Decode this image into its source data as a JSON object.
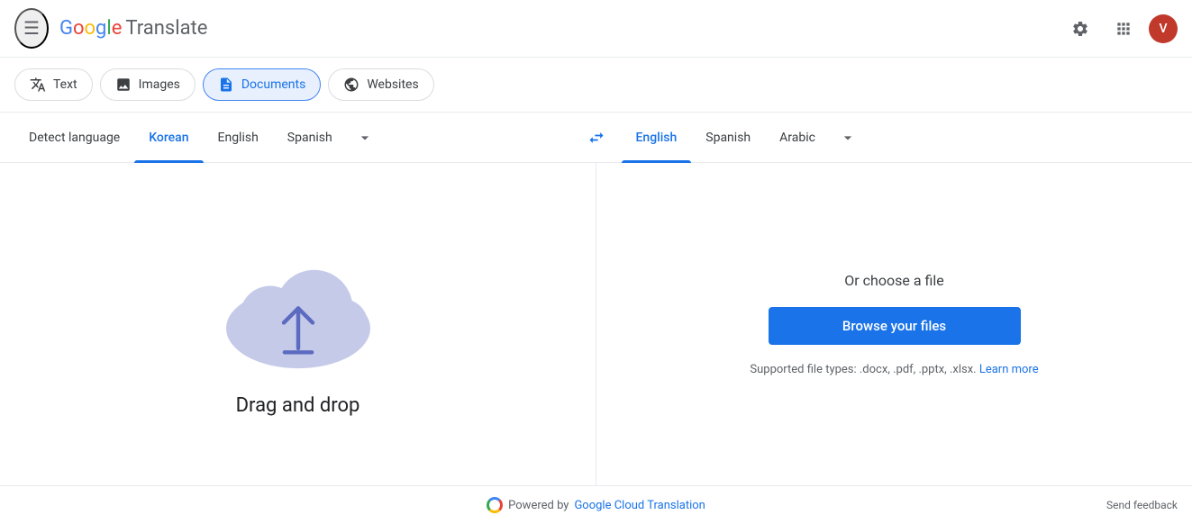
{
  "header": {
    "menu_icon": "☰",
    "logo_text": "Translate",
    "logo_google": "Google",
    "settings_icon": "⚙",
    "apps_icon": "⠿",
    "avatar_label": "V",
    "avatar_bg": "#c0392b"
  },
  "mode_tabs": [
    {
      "id": "text",
      "label": "Text",
      "icon": "𝑇",
      "active": false
    },
    {
      "id": "images",
      "label": "Images",
      "icon": "🖼",
      "active": false
    },
    {
      "id": "documents",
      "label": "Documents",
      "icon": "📄",
      "active": true
    },
    {
      "id": "websites",
      "label": "Websites",
      "icon": "🌐",
      "active": false
    }
  ],
  "source_langs": [
    {
      "id": "detect",
      "label": "Detect language",
      "active": false
    },
    {
      "id": "korean",
      "label": "Korean",
      "active": true
    },
    {
      "id": "english",
      "label": "English",
      "active": false
    },
    {
      "id": "spanish",
      "label": "Spanish",
      "active": false
    }
  ],
  "target_langs": [
    {
      "id": "english",
      "label": "English",
      "active": true
    },
    {
      "id": "spanish",
      "label": "Spanish",
      "active": false
    },
    {
      "id": "arabic",
      "label": "Arabic",
      "active": false
    }
  ],
  "left_panel": {
    "drag_drop_label": "Drag and drop"
  },
  "right_panel": {
    "or_choose_label": "Or choose a file",
    "browse_label": "Browse your files",
    "supported_text": "Supported file types: .docx, .pdf, .pptx, .xlsx.",
    "learn_more_label": "Learn more"
  },
  "footer": {
    "powered_by": "Powered by",
    "gcloud_label": "Google Cloud Translation",
    "send_feedback": "Send feedback"
  }
}
